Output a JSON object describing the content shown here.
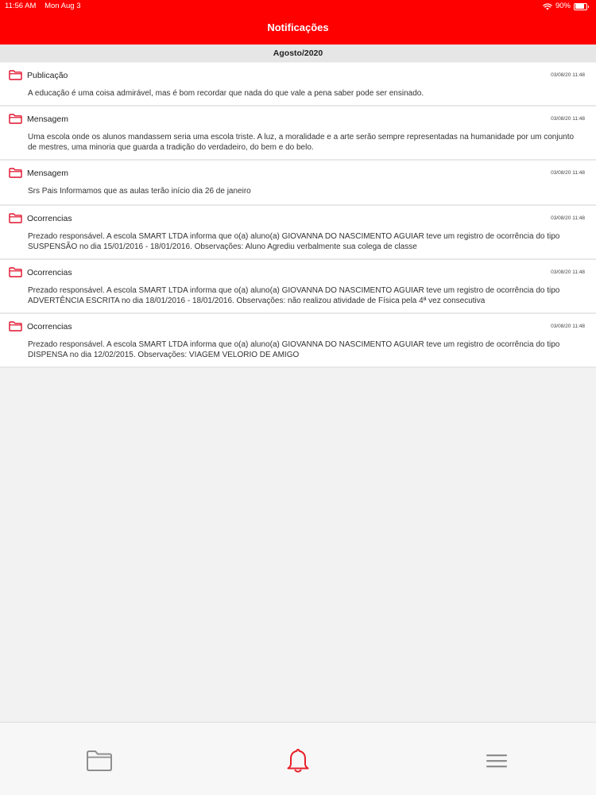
{
  "status_bar": {
    "time": "11:56 AM",
    "date": "Mon Aug 3",
    "battery": "90%",
    "battery_level": 0.9
  },
  "header": {
    "title": "Notificações"
  },
  "month_header": "Agosto/2020",
  "notifications": [
    {
      "title": "Publicação",
      "time": "03/08/20 11:48",
      "body": "A educação é uma coisa admirável, mas é bom recordar que nada do que vale a pena saber pode ser ensinado."
    },
    {
      "title": "Mensagem",
      "time": "03/08/20 11:48",
      "body": "Uma escola onde os alunos mandassem seria uma escola triste. A luz, a moralidade e a arte serão sempre representadas na humanidade por um conjunto de mestres, uma minoria que guarda a tradição do verdadeiro, do bem e do belo."
    },
    {
      "title": "Mensagem",
      "time": "03/08/20 11:48",
      "body": "Srs Pais Informamos que as aulas terão início dia 26 de janeiro"
    },
    {
      "title": "Ocorrencias",
      "time": "03/08/20 11:48",
      "body": "Prezado responsável. A escola SMART LTDA informa que o(a) aluno(a) GIOVANNA DO NASCIMENTO AGUIAR teve um registro de ocorrência do tipo SUSPENSÃO no dia 15/01/2016 - 18/01/2016. Observações: Aluno Agrediu verbalmente sua colega de classe"
    },
    {
      "title": "Ocorrencias",
      "time": "03/08/20 11:48",
      "body": "Prezado responsável. A escola SMART LTDA informa que o(a) aluno(a) GIOVANNA DO NASCIMENTO AGUIAR teve um registro de ocorrência do tipo ADVERTÊNCIA ESCRITA no dia 18/01/2016 - 18/01/2016. Observações: não realizou atividade de Física pela 4ª vez consecutiva"
    },
    {
      "title": "Ocorrencias",
      "time": "03/08/20 11:48",
      "body": "Prezado responsável. A escola SMART LTDA informa que o(a) aluno(a) GIOVANNA DO NASCIMENTO AGUIAR teve um registro de ocorrência do tipo DISPENSA no dia 12/02/2015. Observações: VIAGEM VELORIO DE AMIGO"
    }
  ],
  "tabbar": {
    "tabs": [
      {
        "icon": "folder-icon",
        "active": false
      },
      {
        "icon": "bell-icon",
        "active": true
      },
      {
        "icon": "menu-icon",
        "active": false
      }
    ]
  },
  "colors": {
    "brand": "#ff0000",
    "folder_icon": "#e0102a",
    "tab_inactive": "#8e8e8e",
    "tab_active": "#e8202a"
  }
}
